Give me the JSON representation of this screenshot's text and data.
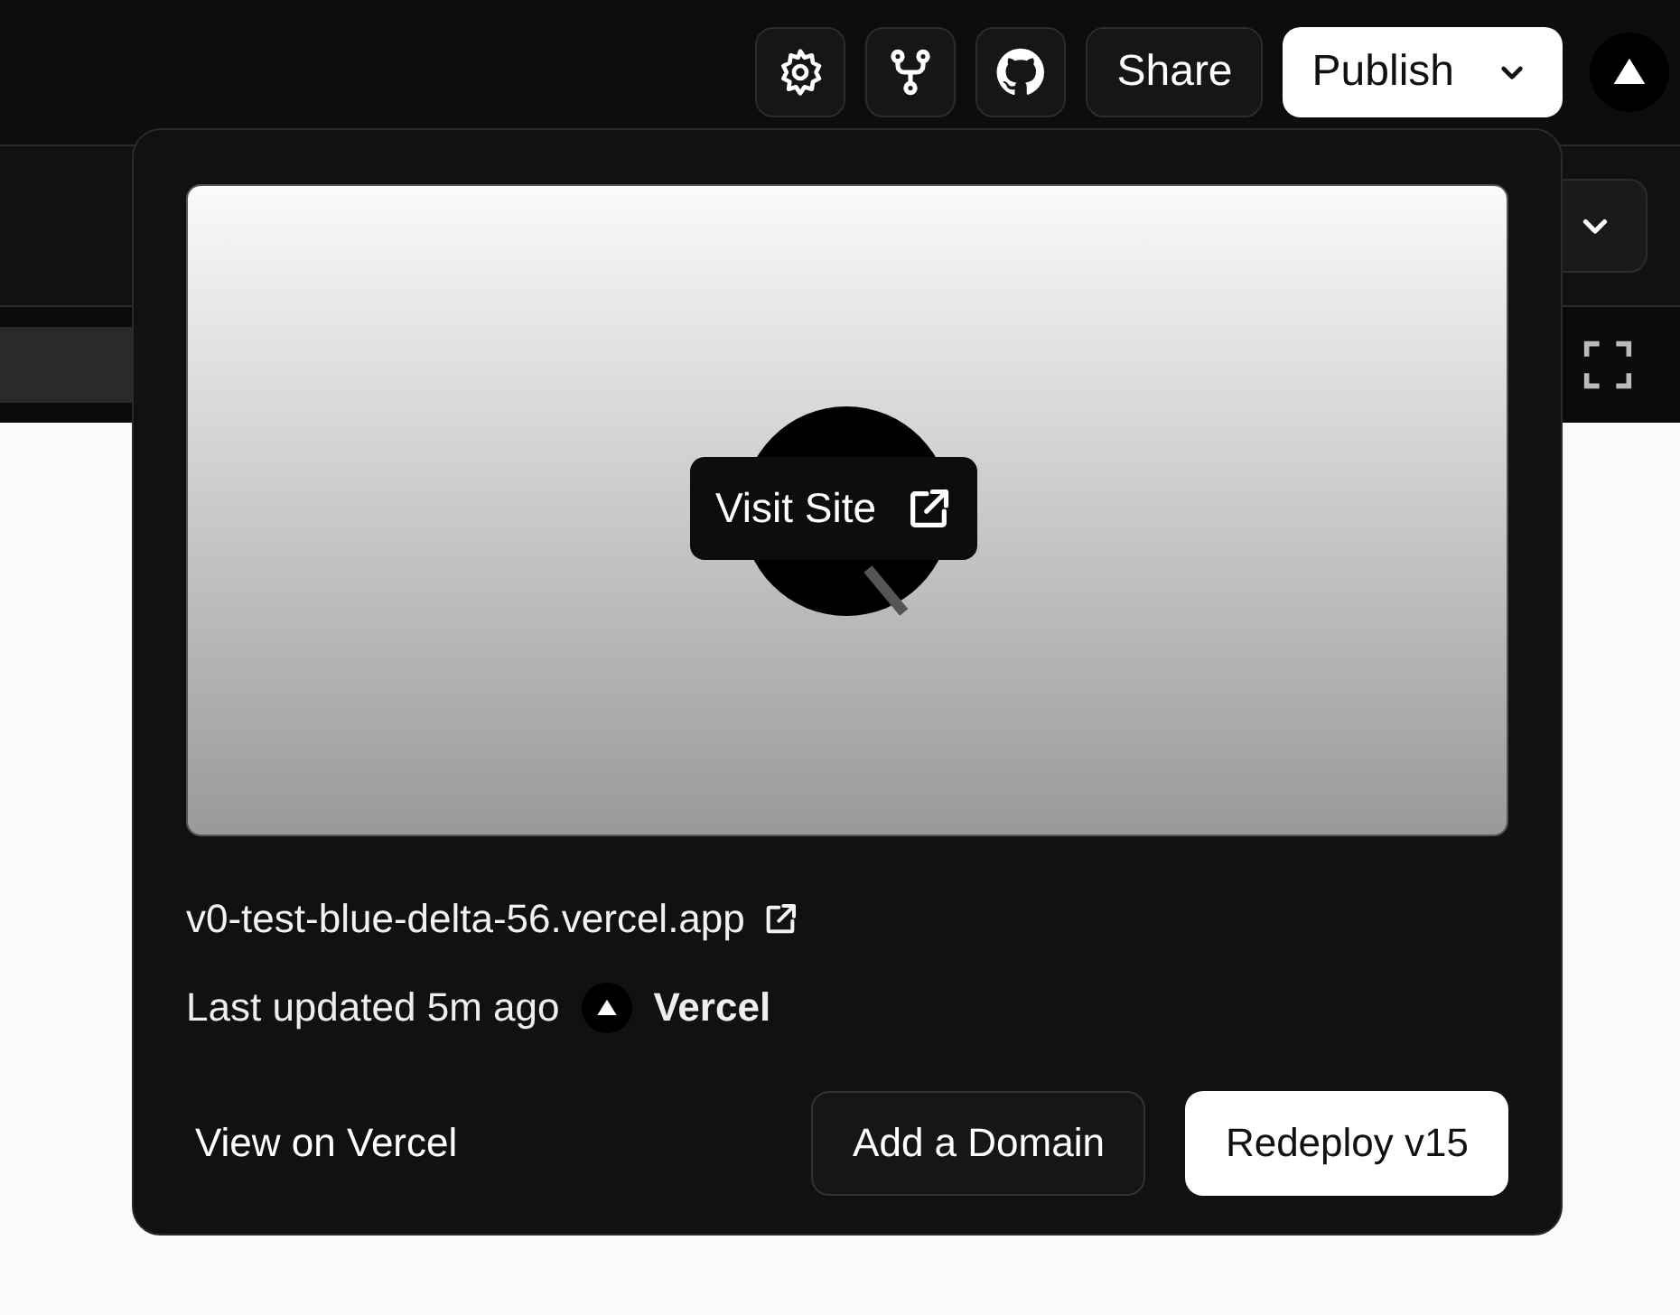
{
  "top_bar": {
    "share_label": "Share",
    "publish_label": "Publish"
  },
  "popover": {
    "preview": {
      "kind": "picture",
      "visit_label": "Visit Site"
    },
    "url": "v0-test-blue-delta-56.vercel.app",
    "last_updated": "Last updated 5m ago",
    "team": "Vercel",
    "actions": [
      {
        "kind": "link",
        "label": "View on Vercel"
      },
      {
        "kind": "secondary",
        "label": "Add a Domain"
      },
      {
        "kind": "primary",
        "label": "Redeploy v15"
      }
    ]
  }
}
